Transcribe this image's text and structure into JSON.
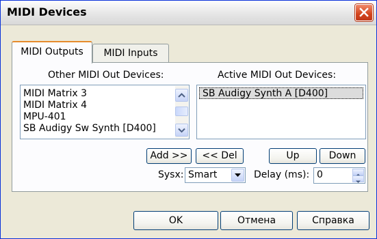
{
  "window": {
    "title": "MIDI Devices"
  },
  "tabs": [
    {
      "label": "MIDI Outputs",
      "active": true
    },
    {
      "label": "MIDI Inputs",
      "active": false
    }
  ],
  "other_devices": {
    "label": "Other MIDI Out Devices:",
    "items": [
      "MIDI Matrix 3",
      "MIDI Matrix 4",
      "MPU-401",
      "SB Audigy Sw Synth [D400]"
    ]
  },
  "active_devices": {
    "label": "Active MIDI Out Devices:",
    "items": [
      "SB Audigy Synth A [D400]"
    ]
  },
  "buttons": {
    "add": "Add >>",
    "del": "<< Del",
    "up": "Up",
    "down": "Down",
    "ok": "OK",
    "cancel": "Отмена",
    "help": "Справка"
  },
  "sysx": {
    "label": "Sysx:",
    "value": "Smart"
  },
  "delay": {
    "label": "Delay (ms):",
    "value": "0"
  },
  "colors": {
    "title_close": "#d2431b",
    "tab_highlight": "#e68b2c",
    "border": "#7f9db9"
  }
}
